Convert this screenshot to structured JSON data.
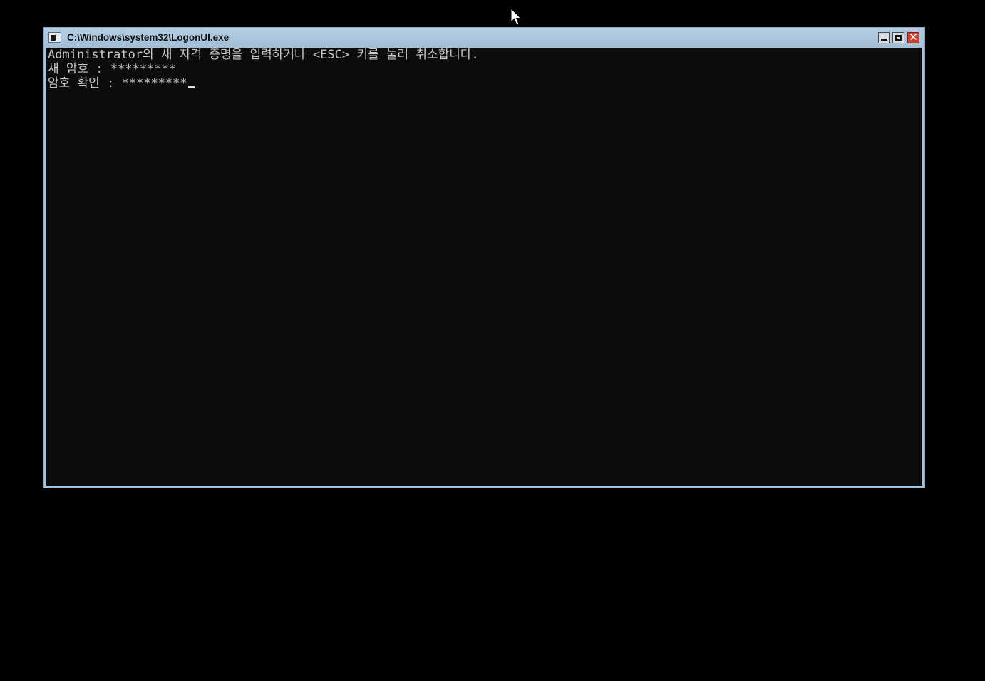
{
  "window": {
    "title": "C:\\Windows\\system32\\LogonUI.exe",
    "icon": "console-app-icon",
    "controls": {
      "minimize": "minimize-icon",
      "maximize": "maximize-icon",
      "close": "close-icon"
    }
  },
  "console": {
    "lines": [
      "Administrator의 새 자격 증명을 입력하거나 <ESC> 키를 눌러 취소합니다.",
      "새 암호 : *********",
      "암호 확인 : *********"
    ]
  },
  "colors": {
    "desktop_bg": "#000000",
    "console_bg": "#0c0c0c",
    "console_text": "#c8c8c8",
    "titlebar": "#a7c3db",
    "close_button": "#c9462c"
  }
}
